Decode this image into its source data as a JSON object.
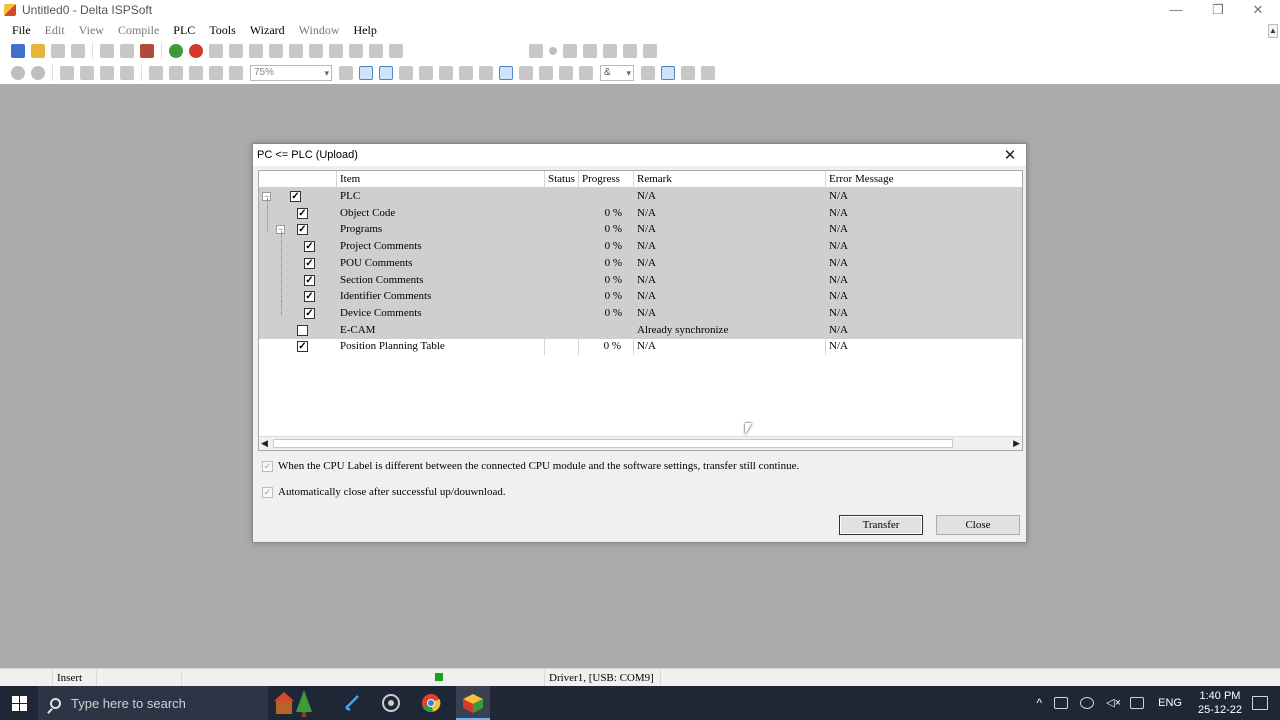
{
  "window": {
    "title": "Untitled0 - Delta ISPSoft"
  },
  "menu": [
    {
      "label": "File",
      "dim": false
    },
    {
      "label": "Edit",
      "dim": true
    },
    {
      "label": "View",
      "dim": true
    },
    {
      "label": "Compile",
      "dim": true
    },
    {
      "label": "PLC",
      "dim": false
    },
    {
      "label": "Tools",
      "dim": false
    },
    {
      "label": "Wizard",
      "dim": false
    },
    {
      "label": "Window",
      "dim": true
    },
    {
      "label": "Help",
      "dim": false
    }
  ],
  "toolbar": {
    "zoom_value": "75%",
    "logic_value": "&"
  },
  "dialog": {
    "title": "PC <= PLC (Upload)",
    "columns": {
      "item": "Item",
      "status": "Status",
      "progress": "Progress",
      "remark": "Remark",
      "error": "Error Message"
    },
    "rows": [
      {
        "item": "PLC",
        "status": "",
        "progress": "",
        "remark": "N/A",
        "error": "N/A",
        "checked": true
      },
      {
        "item": "Object Code",
        "status": "",
        "progress": "0 %",
        "remark": "N/A",
        "error": "N/A",
        "checked": true
      },
      {
        "item": "Programs",
        "status": "",
        "progress": "0 %",
        "remark": "N/A",
        "error": "N/A",
        "checked": true
      },
      {
        "item": "Project Comments",
        "status": "",
        "progress": "0 %",
        "remark": "N/A",
        "error": "N/A",
        "checked": true
      },
      {
        "item": "POU Comments",
        "status": "",
        "progress": "0 %",
        "remark": "N/A",
        "error": "N/A",
        "checked": true
      },
      {
        "item": "Section Comments",
        "status": "",
        "progress": "0 %",
        "remark": "N/A",
        "error": "N/A",
        "checked": true
      },
      {
        "item": "Identifier Comments",
        "status": "",
        "progress": "0 %",
        "remark": "N/A",
        "error": "N/A",
        "checked": true
      },
      {
        "item": "Device Comments",
        "status": "",
        "progress": "0 %",
        "remark": "N/A",
        "error": "N/A",
        "checked": true
      },
      {
        "item": "E-CAM",
        "status": "",
        "progress": "",
        "remark": "Already synchronize",
        "error": "N/A",
        "checked": false
      },
      {
        "item": "Position Planning Table",
        "status": "",
        "progress": "0 %",
        "remark": "N/A",
        "error": "N/A",
        "checked": true
      }
    ],
    "option_cpu_label": "When the CPU Label is different between the connected CPU module and the software settings, transfer still continue.",
    "option_auto_close": "Automatically close after successful up/douwnload.",
    "transfer_label": "Transfer",
    "close_label": "Close"
  },
  "statusbar": {
    "mode": "Insert",
    "driver": "Driver1, [USB: COM9]"
  },
  "taskbar": {
    "search_placeholder": "Type here to search",
    "lang": "ENG",
    "time": "1:40 PM",
    "date": "25-12-22"
  }
}
